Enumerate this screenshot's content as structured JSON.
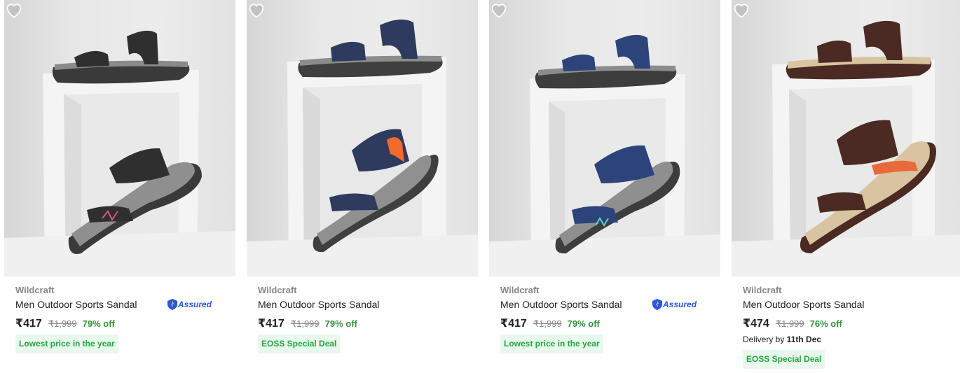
{
  "products": [
    {
      "brand": "Wildcraft",
      "title": "Men Outdoor Sports Sandal",
      "assured": true,
      "price": "₹417",
      "mrp": "₹1,999",
      "discount": "79% off",
      "tag": "Lowest price in the year",
      "strap_color": "#2f2f2f",
      "accent_color": "#e0557a"
    },
    {
      "brand": "Wildcraft",
      "title": "Men Outdoor Sports Sandal",
      "assured": false,
      "price": "₹417",
      "mrp": "₹1,999",
      "discount": "79% off",
      "tag": "EOSS Special Deal",
      "strap_color": "#2e3a5e",
      "accent_color": "#f26b2a"
    },
    {
      "brand": "Wildcraft",
      "title": "Men Outdoor Sports Sandal",
      "assured": true,
      "price": "₹417",
      "mrp": "₹1,999",
      "discount": "79% off",
      "tag": "Lowest price in the year",
      "strap_color": "#2c447a",
      "accent_color": "#5fd0c0"
    },
    {
      "brand": "Wildcraft",
      "title": "Men Outdoor Sports Sandal",
      "assured": false,
      "price": "₹474",
      "mrp": "₹1,999",
      "discount": "76% off",
      "delivery_prefix": "Delivery by",
      "delivery_date": "11th Dec",
      "tag": "EOSS Special Deal",
      "strap_color": "#4a2a22",
      "accent_color": "#e86a3c",
      "sole_color": "#d8c4a0"
    }
  ],
  "assured_label": "Assured",
  "icons": {
    "wishlist": "heart-icon",
    "assured": "assured-shield-icon"
  },
  "colors": {
    "discount": "#388e3c",
    "tag_bg": "#e8f8ec",
    "tag_text": "#26a541",
    "assured": "#2a55e5"
  }
}
